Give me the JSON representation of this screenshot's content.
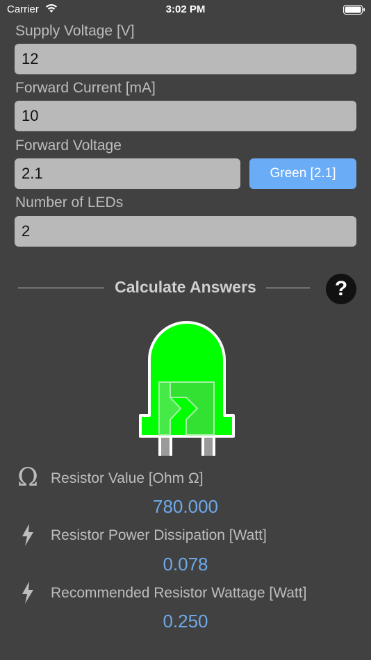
{
  "status_bar": {
    "carrier": "Carrier",
    "time": "3:02 PM"
  },
  "form": {
    "supply_voltage": {
      "label": "Supply Voltage [V]",
      "value": "12"
    },
    "forward_current": {
      "label": "Forward Current [mA]",
      "value": "10"
    },
    "forward_voltage": {
      "label": "Forward Voltage",
      "value": "2.1",
      "preset_button": "Green [2.1]"
    },
    "num_leds": {
      "label": "Number of LEDs",
      "value": "2"
    }
  },
  "calculate": {
    "label": "Calculate Answers",
    "help_label": "?"
  },
  "led": {
    "color": "#00ff00",
    "icon": "led-icon"
  },
  "results": {
    "resistor_value": {
      "icon": "omega-icon",
      "symbol": "Ω",
      "label": "Resistor Value [Ohm Ω]",
      "value": "780.000"
    },
    "power_dissipation": {
      "icon": "lightning-bolt-icon",
      "label": "Resistor Power Dissipation [Watt]",
      "value": "0.078"
    },
    "recommended_wattage": {
      "icon": "lightning-bolt-icon",
      "label": "Recommended Resistor Wattage [Watt]",
      "value": "0.250"
    }
  },
  "colors": {
    "background": "#414141",
    "input_background": "#b9b9b9",
    "accent_blue": "#6bacf6",
    "result_value": "#6ea9e9"
  }
}
